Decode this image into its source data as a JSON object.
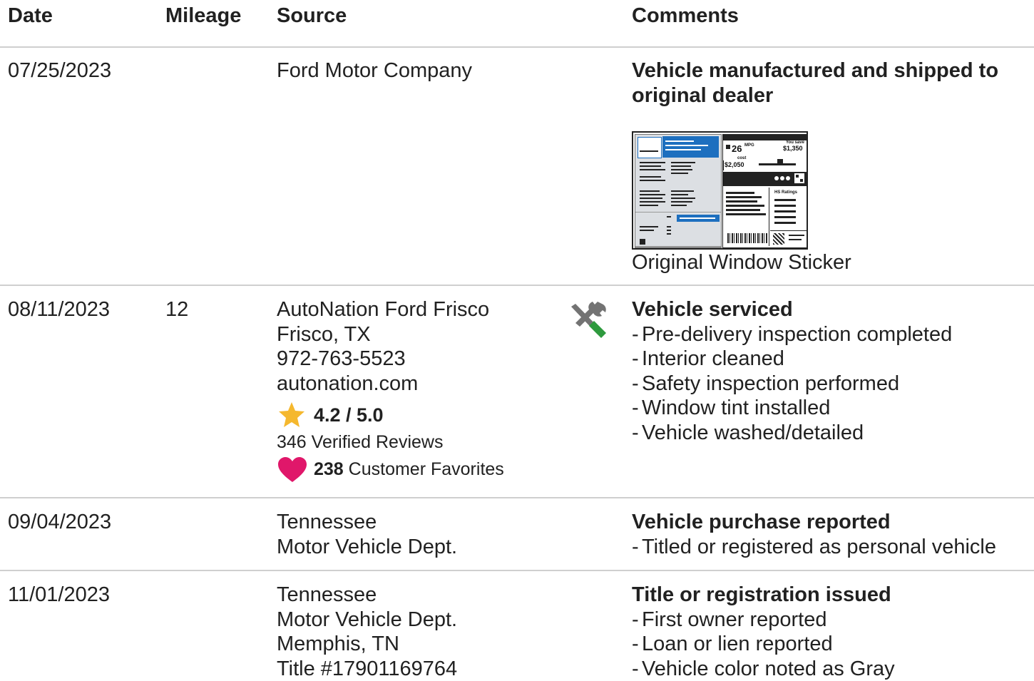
{
  "headers": {
    "date": "Date",
    "mileage": "Mileage",
    "source": "Source",
    "comments": "Comments"
  },
  "rows": [
    {
      "date": "07/25/2023",
      "mileage": "",
      "source": [
        "Ford Motor Company"
      ],
      "comments": {
        "title": "Vehicle manufactured and shipped to original dealer",
        "items": []
      },
      "sticker": {
        "caption": "Original Window Sticker",
        "mpg": "26",
        "mpg_unit": "MPG",
        "you_save_label": "You save",
        "savings": "$1,350",
        "fuel_cost": "$2,050",
        "cost_label": "cost",
        "ratings_label": "HS Ratings"
      }
    },
    {
      "date": "08/11/2023",
      "mileage": "12",
      "source": [
        "AutoNation Ford Frisco",
        "Frisco, TX",
        "972-763-5523",
        "autonation.com"
      ],
      "rating": "4.2 / 5.0",
      "reviews": "346 Verified Reviews",
      "favorites_count": "238",
      "favorites_label": "Customer Favorites",
      "service_icon": "wrench-screwdriver-icon",
      "comments": {
        "title": "Vehicle serviced",
        "items": [
          "Pre-delivery inspection completed",
          "Interior cleaned",
          "Safety inspection performed",
          "Window tint installed",
          "Vehicle washed/detailed"
        ]
      }
    },
    {
      "date": "09/04/2023",
      "mileage": "",
      "source": [
        "Tennessee",
        "Motor Vehicle Dept."
      ],
      "comments": {
        "title": "Vehicle purchase reported",
        "items": [
          "Titled or registered as personal vehicle"
        ]
      }
    },
    {
      "date": "11/01/2023",
      "mileage": "",
      "source": [
        "Tennessee",
        "Motor Vehicle Dept.",
        "Memphis, TN",
        "Title #17901169764"
      ],
      "comments": {
        "title": "Title or registration issued",
        "items": [
          "First owner reported",
          "Loan or lien reported",
          "Vehicle color noted as Gray"
        ]
      }
    }
  ],
  "colors": {
    "star": "#f5b82e",
    "heart": "#e0176a",
    "wrench": "#737373",
    "screwdriver": "#2e9a3e",
    "rule": "#cfcfcf"
  }
}
